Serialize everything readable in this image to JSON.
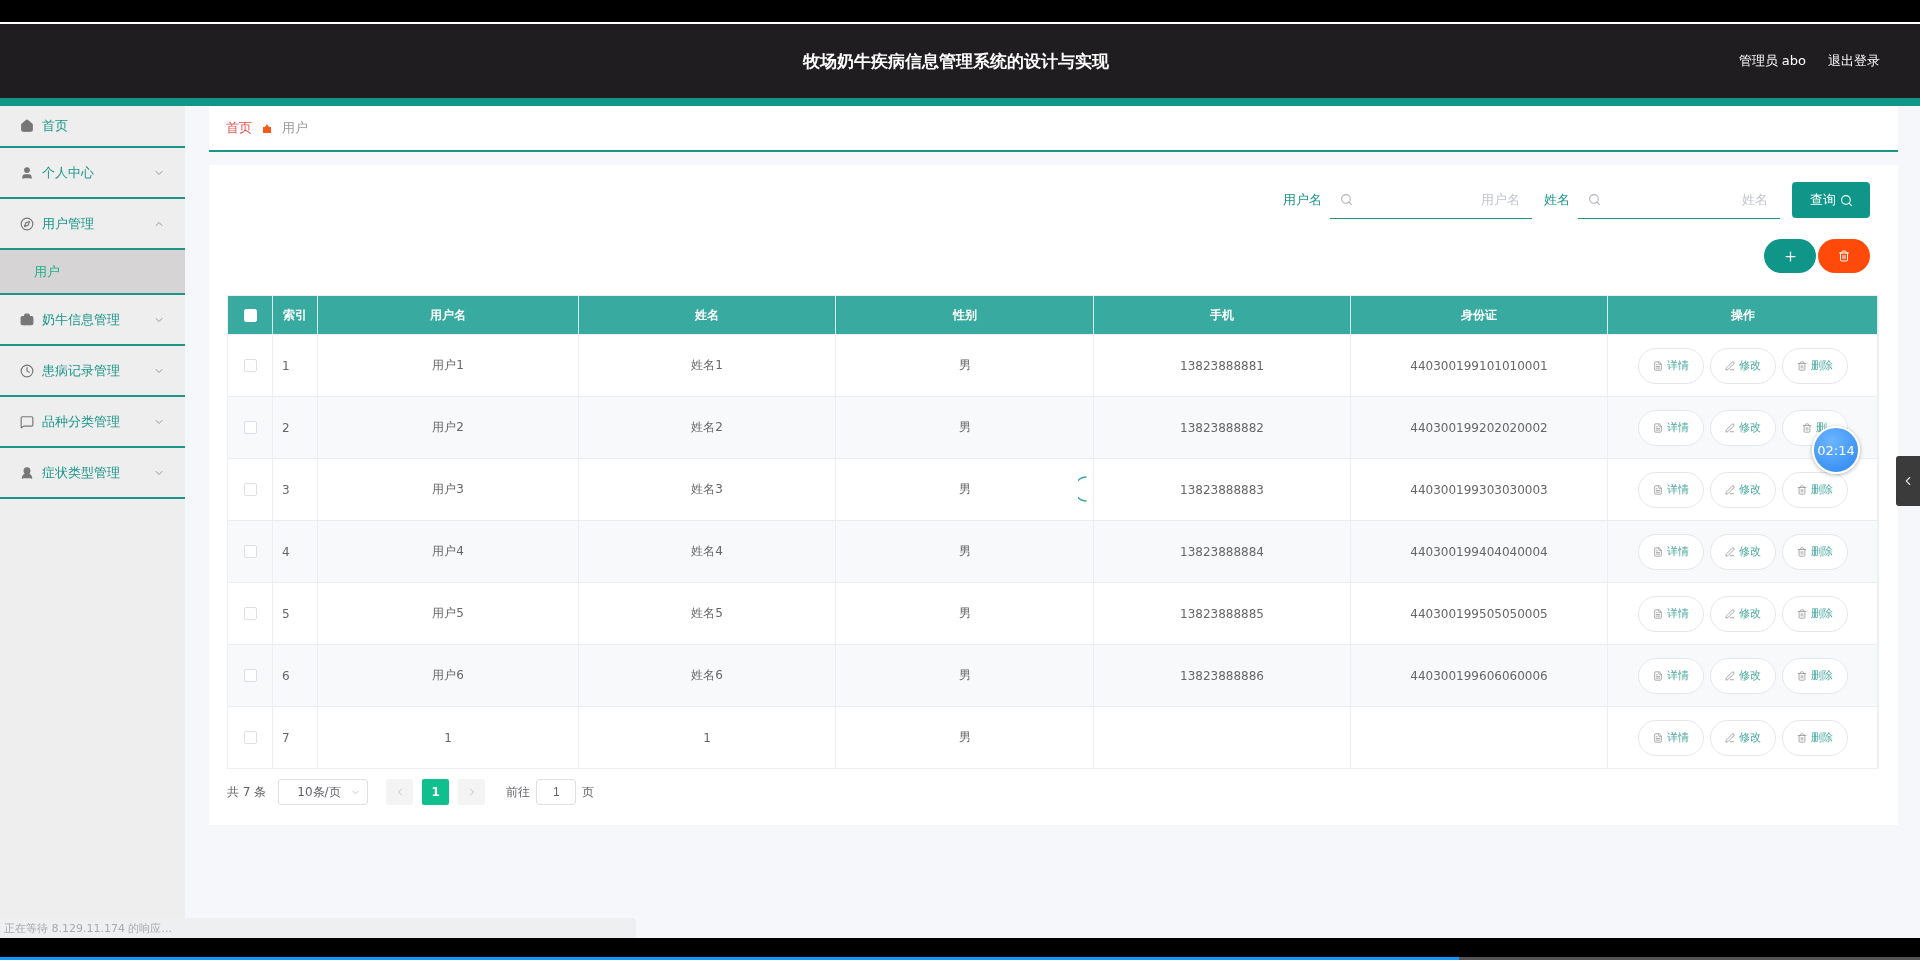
{
  "header": {
    "title": "牧场奶牛疾病信息管理系统的设计与实现",
    "user": "管理员 abo",
    "logout": "退出登录"
  },
  "sidebar": {
    "items": [
      {
        "label": "首页",
        "kind": "link"
      },
      {
        "label": "个人中心",
        "kind": "menu",
        "expanded": false
      },
      {
        "label": "用户管理",
        "kind": "menu",
        "expanded": true,
        "children": [
          {
            "label": "用户",
            "selected": true
          }
        ]
      },
      {
        "label": "奶牛信息管理",
        "kind": "menu",
        "expanded": false
      },
      {
        "label": "患病记录管理",
        "kind": "menu",
        "expanded": false
      },
      {
        "label": "品种分类管理",
        "kind": "menu",
        "expanded": false
      },
      {
        "label": "症状类型管理",
        "kind": "menu",
        "expanded": false
      }
    ]
  },
  "breadcrumb": [
    "首页",
    "用户"
  ],
  "search": {
    "fields": [
      {
        "label": "用户名",
        "placeholder": "用户名"
      },
      {
        "label": "姓名",
        "placeholder": "姓名"
      }
    ],
    "button": "查询"
  },
  "table": {
    "all_checked": false,
    "columns": [
      "索引",
      "用户名",
      "姓名",
      "性别",
      "手机",
      "身份证",
      "操作"
    ],
    "rows": [
      {
        "checked": false,
        "cells": [
          "1",
          "用户1",
          "姓名1",
          "男",
          "13823888881",
          "440300199101010001"
        ],
        "actions": [
          {
            "kind": "detail",
            "label": "详情"
          },
          {
            "kind": "edit",
            "label": "修改"
          },
          {
            "kind": "delete",
            "label": "删除"
          }
        ]
      },
      {
        "checked": false,
        "cells": [
          "2",
          "用户2",
          "姓名2",
          "男",
          "13823888882",
          "440300199202020002"
        ],
        "actions": [
          {
            "kind": "detail",
            "label": "详情"
          },
          {
            "kind": "edit",
            "label": "修改"
          },
          {
            "kind": "delete",
            "label": "删"
          }
        ]
      },
      {
        "checked": false,
        "cells": [
          "3",
          "用户3",
          "姓名3",
          "男",
          "13823888883",
          "440300199303030003"
        ],
        "actions": [
          {
            "kind": "detail",
            "label": "详情"
          },
          {
            "kind": "edit",
            "label": "修改"
          },
          {
            "kind": "delete",
            "label": "删除"
          }
        ]
      },
      {
        "checked": false,
        "cells": [
          "4",
          "用户4",
          "姓名4",
          "男",
          "13823888884",
          "440300199404040004"
        ],
        "actions": [
          {
            "kind": "detail",
            "label": "详情"
          },
          {
            "kind": "edit",
            "label": "修改"
          },
          {
            "kind": "delete",
            "label": "删除"
          }
        ]
      },
      {
        "checked": false,
        "cells": [
          "5",
          "用户5",
          "姓名5",
          "男",
          "13823888885",
          "440300199505050005"
        ],
        "actions": [
          {
            "kind": "detail",
            "label": "详情"
          },
          {
            "kind": "edit",
            "label": "修改"
          },
          {
            "kind": "delete",
            "label": "删除"
          }
        ]
      },
      {
        "checked": false,
        "cells": [
          "6",
          "用户6",
          "姓名6",
          "男",
          "13823888886",
          "440300199606060006"
        ],
        "actions": [
          {
            "kind": "detail",
            "label": "详情"
          },
          {
            "kind": "edit",
            "label": "修改"
          },
          {
            "kind": "delete",
            "label": "删除"
          }
        ]
      },
      {
        "checked": false,
        "cells": [
          "7",
          "1",
          "1",
          "男",
          "",
          ""
        ],
        "actions": [
          {
            "kind": "detail",
            "label": "详情"
          },
          {
            "kind": "edit",
            "label": "修改"
          },
          {
            "kind": "delete",
            "label": "删除"
          }
        ]
      }
    ]
  },
  "pagination": {
    "total": "共 7 条",
    "page_size": "10条/页",
    "pages": [
      {
        "label": "1",
        "selected": true
      }
    ],
    "goto_label": "前往",
    "goto_value": "1",
    "goto_suffix": "页"
  },
  "timer": "02:14",
  "status_text": "正在等待 8.129.11.174 的响应...",
  "video": {
    "level": 0.76
  }
}
